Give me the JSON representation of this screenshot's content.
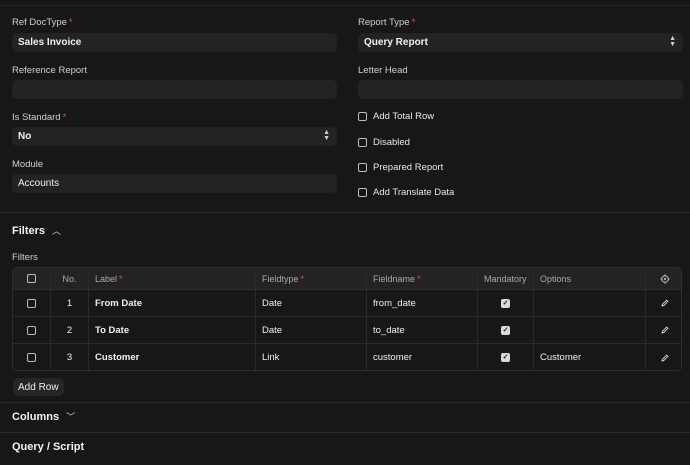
{
  "form": {
    "ref_doctype": {
      "label": "Ref DocType",
      "value": "Sales Invoice"
    },
    "report_type": {
      "label": "Report Type",
      "value": "Query Report"
    },
    "reference_report": {
      "label": "Reference Report",
      "value": ""
    },
    "letter_head": {
      "label": "Letter Head",
      "value": ""
    },
    "is_standard": {
      "label": "Is Standard",
      "value": "No"
    },
    "module": {
      "label": "Module",
      "value": "Accounts"
    },
    "required_mark": "*",
    "checkboxes": [
      {
        "label": "Add Total Row",
        "checked": false
      },
      {
        "label": "Disabled",
        "checked": false
      },
      {
        "label": "Prepared Report",
        "checked": false
      },
      {
        "label": "Add Translate Data",
        "checked": false
      }
    ]
  },
  "sections": {
    "filters": {
      "title": "Filters",
      "chevron": "chevron-up-icon"
    },
    "columns": {
      "title": "Columns",
      "chevron": "chevron-down-icon"
    },
    "query": {
      "title": "Query / Script"
    }
  },
  "filters_table": {
    "caption": "Filters",
    "headers": {
      "no": "No.",
      "label": "Label",
      "fieldtype": "Fieldtype",
      "fieldname": "Fieldname",
      "mandatory": "Mandatory",
      "options": "Options"
    },
    "rows": [
      {
        "no": "1",
        "label": "From Date",
        "fieldtype": "Date",
        "fieldname": "from_date",
        "mandatory": true,
        "options": ""
      },
      {
        "no": "2",
        "label": "To Date",
        "fieldtype": "Date",
        "fieldname": "to_date",
        "mandatory": true,
        "options": ""
      },
      {
        "no": "3",
        "label": "Customer",
        "fieldtype": "Link",
        "fieldname": "customer",
        "mandatory": true,
        "options": "Customer"
      }
    ],
    "add_row_label": "Add Row"
  },
  "icons": {
    "settings": "gear-icon",
    "edit": "pencil-icon",
    "checkmark": "✓"
  }
}
